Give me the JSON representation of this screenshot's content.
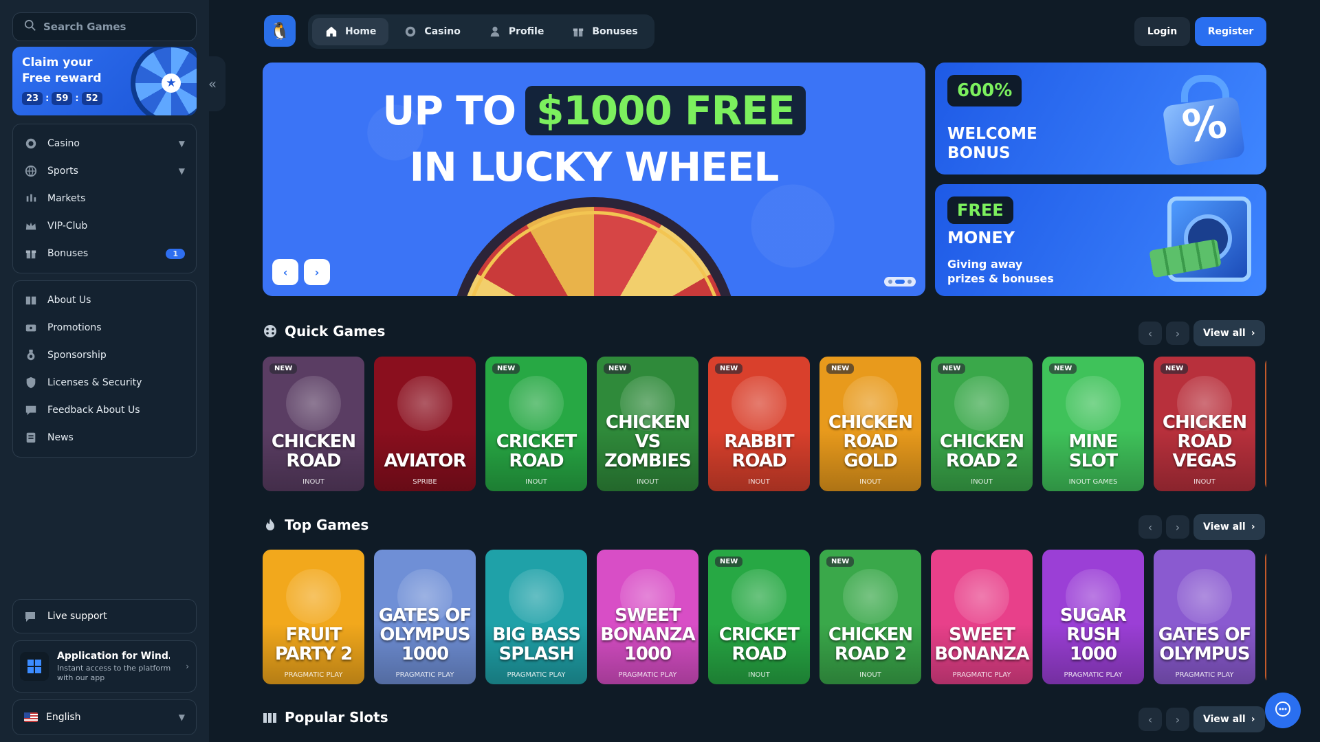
{
  "sidebar": {
    "search_placeholder": "Search Games",
    "reward": {
      "title": "Claim your Free reward",
      "timer": [
        "23",
        "59",
        "52"
      ]
    },
    "main_menu": [
      {
        "label": "Casino",
        "icon": "casino-chip-icon",
        "chevron": true
      },
      {
        "label": "Sports",
        "icon": "globe-ball-icon",
        "chevron": true
      },
      {
        "label": "Markets",
        "icon": "candles-chart-icon"
      },
      {
        "label": "VIP-Club",
        "icon": "crown-icon"
      },
      {
        "label": "Bonuses",
        "icon": "gift-icon",
        "badge": "1"
      }
    ],
    "info_menu": [
      {
        "label": "About Us",
        "icon": "book-icon"
      },
      {
        "label": "Promotions",
        "icon": "ticket-icon"
      },
      {
        "label": "Sponsorship",
        "icon": "medal-icon"
      },
      {
        "label": "Licenses & Security",
        "icon": "shield-icon"
      },
      {
        "label": "Feedback About Us",
        "icon": "feedback-icon"
      },
      {
        "label": "News",
        "icon": "newspaper-icon"
      }
    ],
    "support_label": "Live support",
    "app": {
      "title": "Application for Wind…",
      "subtitle": "Instant access to the platform with our app"
    },
    "language": "English"
  },
  "nav": {
    "tabs": [
      {
        "label": "Home",
        "icon": "home-icon",
        "active": true
      },
      {
        "label": "Casino",
        "icon": "casino-chip-icon"
      },
      {
        "label": "Profile",
        "icon": "user-icon"
      },
      {
        "label": "Bonuses",
        "icon": "gift-icon"
      }
    ],
    "login": "Login",
    "register": "Register"
  },
  "hero": {
    "line1_prefix": "UP TO",
    "line1_highlight": "$1000 FREE",
    "line2": "IN LUCKY WHEEL",
    "slides": 3,
    "active_slide": 2
  },
  "promos": {
    "welcome": {
      "badge": "600%",
      "title": "WELCOME BONUS"
    },
    "money": {
      "badge": "FREE",
      "title": "MONEY",
      "subtitle": "Giving away prizes & bonuses"
    }
  },
  "sections": {
    "quick": {
      "title": "Quick Games",
      "view_all": "View all",
      "games": [
        {
          "title": "CHICKEN ROAD",
          "provider": "INOUT",
          "new": true,
          "bg": "#5a3d63"
        },
        {
          "title": "AVIATOR",
          "provider": "SPRIBE",
          "new": false,
          "bg": "#8a0f1e"
        },
        {
          "title": "CRICKET ROAD",
          "provider": "INOUT",
          "new": true,
          "bg": "#27a844"
        },
        {
          "title": "CHICKEN VS ZOMBIES",
          "provider": "INOUT",
          "new": true,
          "bg": "#2f8a3a"
        },
        {
          "title": "RABBIT ROAD",
          "provider": "INOUT",
          "new": true,
          "bg": "#d9402c"
        },
        {
          "title": "CHICKEN ROAD GOLD",
          "provider": "INOUT",
          "new": true,
          "bg": "#e89a1c"
        },
        {
          "title": "CHICKEN ROAD 2",
          "provider": "INOUT",
          "new": true,
          "bg": "#3aa84a"
        },
        {
          "title": "MINE SLOT",
          "provider": "INOUT GAMES",
          "new": true,
          "bg": "#3fc25a"
        },
        {
          "title": "CHICKEN ROAD VEGAS",
          "provider": "INOUT",
          "new": true,
          "bg": "#b8303c"
        }
      ]
    },
    "top": {
      "title": "Top Games",
      "view_all": "View all",
      "games": [
        {
          "title": "FRUIT PARTY 2",
          "provider": "PRAGMATIC PLAY",
          "new": false,
          "bg": "#f2a81c"
        },
        {
          "title": "GATES OF OLYMPUS 1000",
          "provider": "PRAGMATIC PLAY",
          "new": false,
          "bg": "#6f8fd6"
        },
        {
          "title": "BIG BASS SPLASH",
          "provider": "PRAGMATIC PLAY",
          "new": false,
          "bg": "#1fa1a8"
        },
        {
          "title": "SWEET BONANZA 1000",
          "provider": "PRAGMATIC PLAY",
          "new": false,
          "bg": "#d84ec6"
        },
        {
          "title": "CRICKET ROAD",
          "provider": "INOUT",
          "new": true,
          "bg": "#27a844"
        },
        {
          "title": "CHICKEN ROAD 2",
          "provider": "INOUT",
          "new": true,
          "bg": "#3aa84a"
        },
        {
          "title": "SWEET BONANZA",
          "provider": "PRAGMATIC PLAY",
          "new": false,
          "bg": "#e8408a"
        },
        {
          "title": "SUGAR RUSH 1000",
          "provider": "PRAGMATIC PLAY",
          "new": false,
          "bg": "#9b3fd6"
        },
        {
          "title": "GATES OF OLYMPUS",
          "provider": "PRAGMATIC PLAY",
          "new": false,
          "bg": "#8a5ad0"
        }
      ]
    },
    "popular": {
      "title": "Popular Slots",
      "view_all": "View all"
    }
  },
  "colors": {
    "accent": "#2a6ff0",
    "bg": "#0f1b26",
    "sidebar": "#172533",
    "highlight_green": "#7cf05e"
  }
}
